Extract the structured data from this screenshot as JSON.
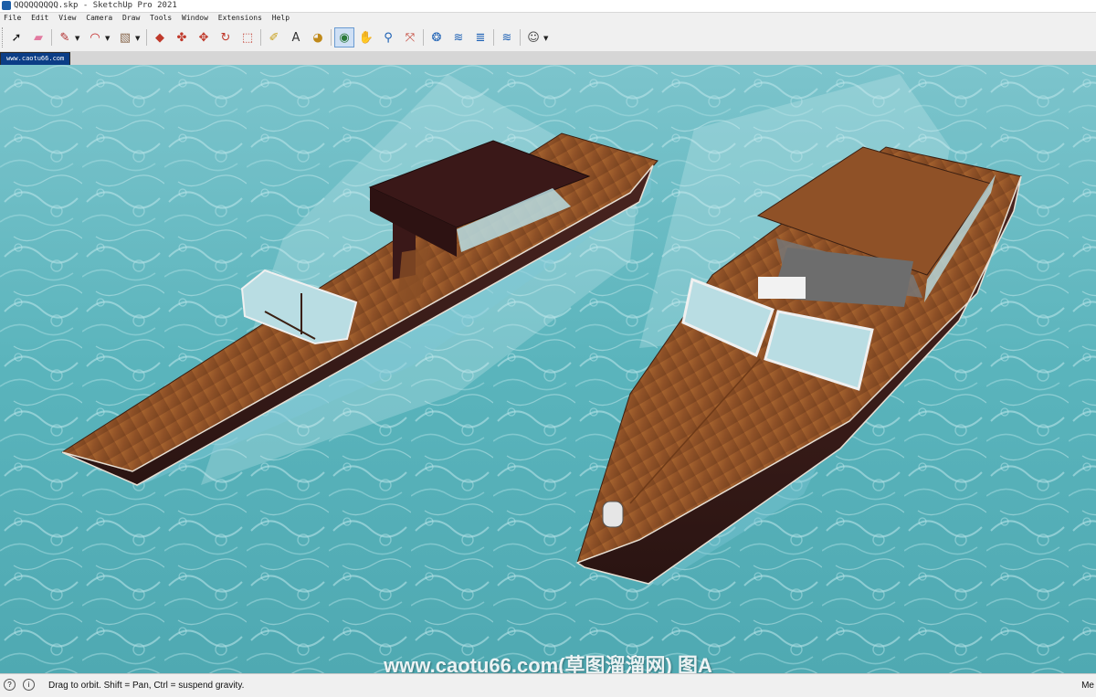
{
  "window": {
    "title": "QQQQQQQQQ.skp - SketchUp Pro 2021"
  },
  "menu": [
    "File",
    "Edit",
    "View",
    "Camera",
    "Draw",
    "Tools",
    "Window",
    "Extensions",
    "Help"
  ],
  "toolbar": {
    "tools": [
      {
        "name": "select-tool",
        "icon": "arrow-icon",
        "glyph": "➚",
        "color": "#111111",
        "active": false
      },
      {
        "name": "eraser-tool",
        "icon": "eraser-icon",
        "glyph": "▰",
        "color": "#e27aa0",
        "active": false
      },
      {
        "name": "line-tool",
        "icon": "pencil-icon",
        "glyph": "✎",
        "color": "#b02a2a",
        "active": false
      },
      {
        "name": "arc-tool",
        "icon": "arc-icon",
        "glyph": "◠",
        "color": "#c22020",
        "active": false
      },
      {
        "name": "shape-tool",
        "icon": "rectangle-icon",
        "glyph": "▧",
        "color": "#8a6a50",
        "active": false
      },
      {
        "name": "push-pull-tool",
        "icon": "push-pull-icon",
        "glyph": "◆",
        "color": "#c0392b",
        "active": false
      },
      {
        "name": "offset-tool",
        "icon": "offset-icon",
        "glyph": "✤",
        "color": "#c0392b",
        "active": false
      },
      {
        "name": "move-tool",
        "icon": "move-icon",
        "glyph": "✥",
        "color": "#c0392b",
        "active": false
      },
      {
        "name": "rotate-tool",
        "icon": "rotate-icon",
        "glyph": "↻",
        "color": "#c0392b",
        "active": false
      },
      {
        "name": "scale-tool",
        "icon": "scale-icon",
        "glyph": "⬚",
        "color": "#c0392b",
        "active": false
      },
      {
        "name": "tape-measure-tool",
        "icon": "tape-icon",
        "glyph": "✐",
        "color": "#c8a01b",
        "active": false
      },
      {
        "name": "text-tool",
        "icon": "text-icon",
        "glyph": "A",
        "color": "#333333",
        "active": false
      },
      {
        "name": "paint-bucket-tool",
        "icon": "paint-bucket-icon",
        "glyph": "◕",
        "color": "#c08a1a",
        "active": false
      },
      {
        "name": "orbit-tool",
        "icon": "orbit-icon",
        "glyph": "◉",
        "color": "#2b7a3a",
        "active": true
      },
      {
        "name": "pan-tool",
        "icon": "hand-icon",
        "glyph": "✋",
        "color": "#c8a01b",
        "active": false
      },
      {
        "name": "zoom-tool",
        "icon": "zoom-icon",
        "glyph": "⚲",
        "color": "#1a5fb4",
        "active": false
      },
      {
        "name": "zoom-extents-tool",
        "icon": "zoom-extents-icon",
        "glyph": "⤧",
        "color": "#c0392b",
        "active": false
      },
      {
        "name": "3d-warehouse-tool",
        "icon": "warehouse-icon",
        "glyph": "❂",
        "color": "#1a5fb4",
        "active": false
      },
      {
        "name": "extension-warehouse-tool",
        "icon": "extension-icon",
        "glyph": "≋",
        "color": "#1a5fb4",
        "active": false
      },
      {
        "name": "layout-tool",
        "icon": "layout-icon",
        "glyph": "≣",
        "color": "#1a5fb4",
        "active": false
      },
      {
        "name": "extension-manager-tool",
        "icon": "extension-manager-icon",
        "glyph": "≋",
        "color": "#1a5fb4",
        "active": false
      },
      {
        "name": "profile-tool",
        "icon": "user-icon",
        "glyph": "☺",
        "color": "#444444",
        "active": false
      }
    ]
  },
  "scene_tab": {
    "label": "www.caotu66.com"
  },
  "watermark": {
    "text": "www.caotu66.com(草图溜溜网) 图A"
  },
  "status": {
    "message": "Drag to orbit. Shift = Pan, Ctrl = suspend gravity.",
    "measure_label": "Me"
  },
  "colors": {
    "water": "#5fb8c0",
    "hull": "#3d1f1d",
    "deck_wood": "#9a5a2c",
    "canopy": "#3a1818",
    "glass": "#b9dde3",
    "orbit_highlight": "#cfe0f5"
  }
}
